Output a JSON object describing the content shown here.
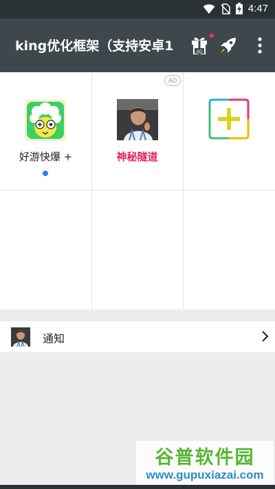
{
  "status_bar": {
    "time": "4:47"
  },
  "app_bar": {
    "title": "king优化框架（支持安卓1"
  },
  "grid": {
    "ad_badge": "AD",
    "items": [
      {
        "label": "好游快爆 +",
        "icon": "haoyou-app-icon",
        "has_new_dot": true
      },
      {
        "label": "神秘隧道",
        "icon": "portrait-app-icon",
        "label_color": "#e4245a"
      },
      {
        "label": "",
        "icon": "add-plus-icon"
      }
    ]
  },
  "notice": {
    "label": "通知"
  },
  "watermark": {
    "title": "谷普软件园",
    "url": "www.gupuxiazai.com"
  },
  "colors": {
    "app_bar": "#3d474c",
    "status_bar": "#2a3135",
    "accent_red": "#e4245a",
    "new_dot": "#2f80e0"
  }
}
